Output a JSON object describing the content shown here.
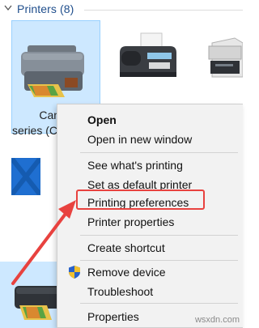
{
  "header": {
    "title": "Printers (8)"
  },
  "printers": [
    {
      "label_line1": "Canon",
      "label_line2": "series (C",
      "icon": "inkjet-printer-icon"
    },
    {
      "icon": "fax-machine-icon"
    },
    {
      "icon": "laser-printer-icon"
    }
  ],
  "context_menu": {
    "items": [
      "Open",
      "Open in new window",
      "See what's printing",
      "Set as default printer",
      "Printing preferences",
      "Printer properties",
      "Create shortcut",
      "Remove device",
      "Troubleshoot",
      "Properties"
    ]
  },
  "annotation": {
    "color": "#e8423f"
  },
  "watermark": "wsxdn.com"
}
